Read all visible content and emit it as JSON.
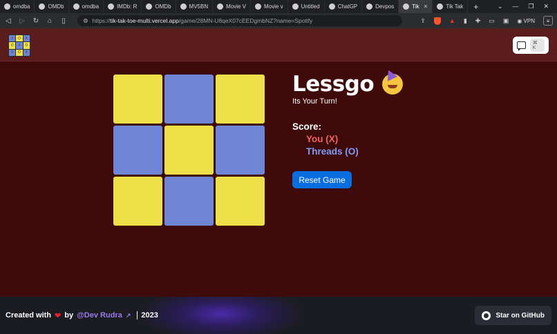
{
  "browser": {
    "tabs": [
      {
        "label": "omdba"
      },
      {
        "label": "OMDb"
      },
      {
        "label": "omdba"
      },
      {
        "label": "IMDb: R"
      },
      {
        "label": "OMDb"
      },
      {
        "label": "MV5BN"
      },
      {
        "label": "Movie V"
      },
      {
        "label": "Movie v"
      },
      {
        "label": "Untitled"
      },
      {
        "label": "ChatGP"
      },
      {
        "label": "Devpos"
      },
      {
        "label": "Tik",
        "active": true
      },
      {
        "label": "Tik Tak"
      }
    ],
    "new_tab": "+",
    "url_prefix": "https://",
    "url_host": "tik-tak-toe-multi.vercel.app",
    "url_path": "/game/28MN-U8qeX07cEEDgmbNZ?name=Spotify",
    "vpn_label": "VPN"
  },
  "header": {
    "logo_marks": [
      "X",
      "O",
      "X",
      "O",
      "X",
      "O",
      "X",
      "O",
      "X"
    ],
    "shortcut": "⌘ K"
  },
  "board": {
    "cells": [
      "yellow",
      "blue",
      "yellow",
      "blue",
      "yellow",
      "blue",
      "yellow",
      "blue",
      "yellow"
    ]
  },
  "game": {
    "title": "Lessgo",
    "status": "Its Your Turn!",
    "score_label": "Score:",
    "you_label": "You (X)",
    "opponent_label": "Threads (O)",
    "reset_label": "Reset Game"
  },
  "footer": {
    "created_with": "Created with",
    "by": "by",
    "author": "@Dev Rudra",
    "year": "2023",
    "star_label": "Star on GitHub"
  }
}
